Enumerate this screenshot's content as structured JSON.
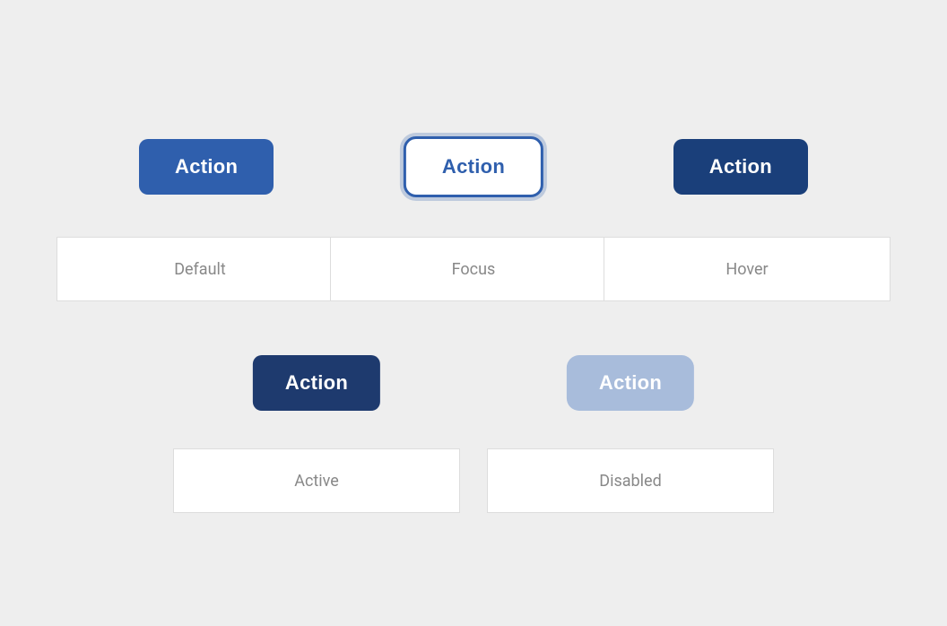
{
  "buttons": {
    "default": {
      "label": "Action",
      "state": "Default",
      "state_label": "Default"
    },
    "focus": {
      "label": "Action",
      "state": "Focus",
      "state_label": "Focus"
    },
    "hover": {
      "label": "Action",
      "state": "Hover",
      "state_label": "Hover"
    },
    "active": {
      "label": "Action",
      "state": "Active",
      "state_label": "Active"
    },
    "disabled": {
      "label": "Action",
      "state": "Disabled",
      "state_label": "Disabled"
    }
  },
  "colors": {
    "default_bg": "#2f5fad",
    "hover_bg": "#1a3f7a",
    "focus_bg": "#ffffff",
    "focus_border": "#2f5fad",
    "active_bg": "#1e3a6e",
    "disabled_bg": "#a8bcdb",
    "page_bg": "#eeeeee",
    "label_text": "#888888"
  }
}
